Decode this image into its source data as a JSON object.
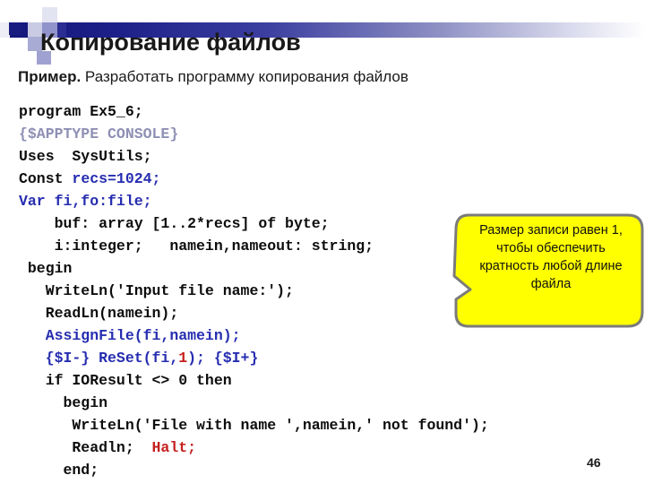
{
  "slide": {
    "title": "Копирование файлов",
    "page_number": "46",
    "accent_color": "#1a1d80",
    "callout_color": "#ffff00",
    "code_blue": "#262db0",
    "code_red": "#c4201e",
    "code_gray": "#8e90b4"
  },
  "subtitle": {
    "bold_part": "Пример.",
    "rest_part": " Разработать программу копирования файлов"
  },
  "code": {
    "lines": [
      [
        {
          "t": "program Ex5_6;",
          "c": "plain"
        }
      ],
      [
        {
          "t": "{$APPTYPE CONSOLE}",
          "c": "gray"
        }
      ],
      [
        {
          "t": "Uses  SysUtils;",
          "c": "plain"
        }
      ],
      [
        {
          "t": "Const ",
          "c": "plain"
        },
        {
          "t": "recs=1024;",
          "c": "blue"
        }
      ],
      [
        {
          "t": "Var fi,fo:file;",
          "c": "blue"
        }
      ],
      [
        {
          "t": "    buf: array [1..2*recs] of byte;",
          "c": "plain"
        }
      ],
      [
        {
          "t": "    i:integer;   namein,nameout: string;",
          "c": "plain"
        }
      ],
      [
        {
          "t": " begin",
          "c": "plain"
        }
      ],
      [
        {
          "t": "   WriteLn('Input file name:');",
          "c": "plain"
        }
      ],
      [
        {
          "t": "   ReadLn(namein);",
          "c": "plain"
        }
      ],
      [
        {
          "t": "   AssignFile(fi,namein);",
          "c": "blue"
        }
      ],
      [
        {
          "t": "   {$I-} ReSet(fi,",
          "c": "blue"
        },
        {
          "t": "1",
          "c": "red"
        },
        {
          "t": "); {$I+}",
          "c": "blue"
        }
      ],
      [
        {
          "t": "   if IOResult <> 0 then",
          "c": "plain"
        }
      ],
      [
        {
          "t": "     begin",
          "c": "plain"
        }
      ],
      [
        {
          "t": "      WriteLn('File with name ',namein,' not found');",
          "c": "plain"
        }
      ],
      [
        {
          "t": "      Readln;  ",
          "c": "plain"
        },
        {
          "t": "Halt;",
          "c": "red"
        }
      ],
      [
        {
          "t": "     end;",
          "c": "plain"
        }
      ]
    ]
  },
  "callout": {
    "text": "Размер записи равен 1, чтобы обеспечить кратность любой длине файла"
  }
}
